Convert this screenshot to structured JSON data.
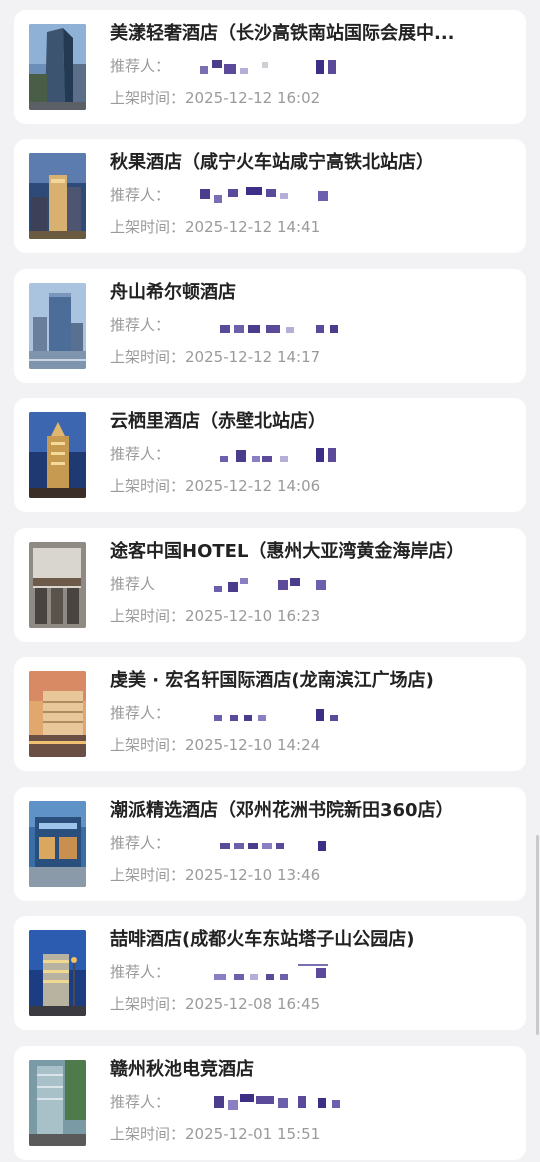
{
  "labels": {
    "referrer": "推荐人：",
    "listed_time": "上架时间："
  },
  "hotels": [
    {
      "name": "美漾轻奢酒店（长沙高铁南站国际会展中...",
      "referrer_label": "推荐人：",
      "listed_time": "2025-12-12 16:02"
    },
    {
      "name": "秋果酒店（咸宁火车站咸宁高铁北站店）",
      "referrer_label": "推荐人：",
      "listed_time": "2025-12-12 14:41"
    },
    {
      "name": "舟山希尔顿酒店",
      "referrer_label": "推荐人：",
      "listed_time": "2025-12-12 14:17"
    },
    {
      "name": "云栖里酒店（赤壁北站店）",
      "referrer_label": "推荐人：",
      "listed_time": "2025-12-12 14:06"
    },
    {
      "name": "途客中国HOTEL（惠州大亚湾黄金海岸店）",
      "referrer_label": "推荐人",
      "listed_time": "2025-12-10 16:23"
    },
    {
      "name": "虔美 · 宏名轩国际酒店(龙南滨江广场店)",
      "referrer_label": "推荐人：",
      "listed_time": "2025-12-10 14:24"
    },
    {
      "name": "潮派精选酒店（邓州花洲书院新田360店）",
      "referrer_label": "推荐人：",
      "listed_time": "2025-12-10 13:46"
    },
    {
      "name": "喆啡酒店(成都火车东站塔子山公园店)",
      "referrer_label": "推荐人：",
      "listed_time": "2025-12-08 16:45"
    },
    {
      "name": "赣州秋池电竞酒店",
      "referrer_label": "推荐人：",
      "listed_time": "2025-12-01 15:51"
    }
  ],
  "colors": {
    "background": "#f2f2f4",
    "card": "#ffffff",
    "title": "#222222",
    "meta_text": "#9a9a9a",
    "mosaic": "#5b4a9a"
  }
}
